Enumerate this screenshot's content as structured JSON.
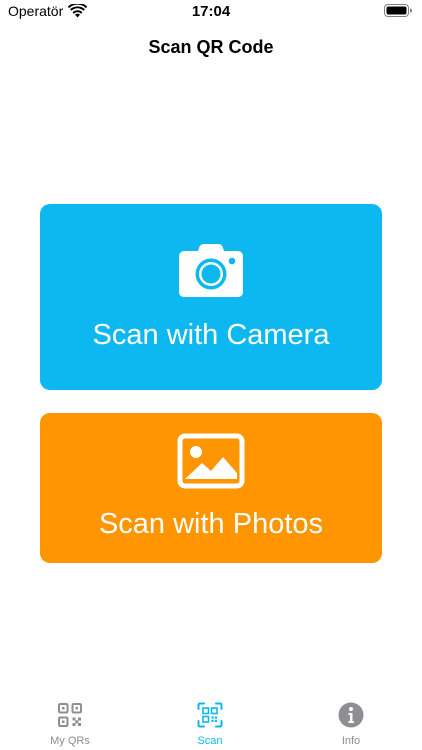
{
  "status_bar": {
    "carrier": "Operatör",
    "time": "17:04"
  },
  "nav": {
    "title": "Scan QR Code"
  },
  "actions": {
    "camera": {
      "label": "Scan with Camera",
      "icon": "camera-icon",
      "color": "#0DB8F0"
    },
    "photos": {
      "label": "Scan with Photos",
      "icon": "photo-icon",
      "color": "#FF9500"
    }
  },
  "tab_bar": {
    "active_color": "#0DB8F0",
    "inactive_color": "#8E8E93",
    "tabs": [
      {
        "label": "My QRs",
        "icon": "qr-code-icon",
        "active": false
      },
      {
        "label": "Scan",
        "icon": "qr-scan-icon",
        "active": true
      },
      {
        "label": "Info",
        "icon": "info-icon",
        "active": false
      }
    ]
  }
}
